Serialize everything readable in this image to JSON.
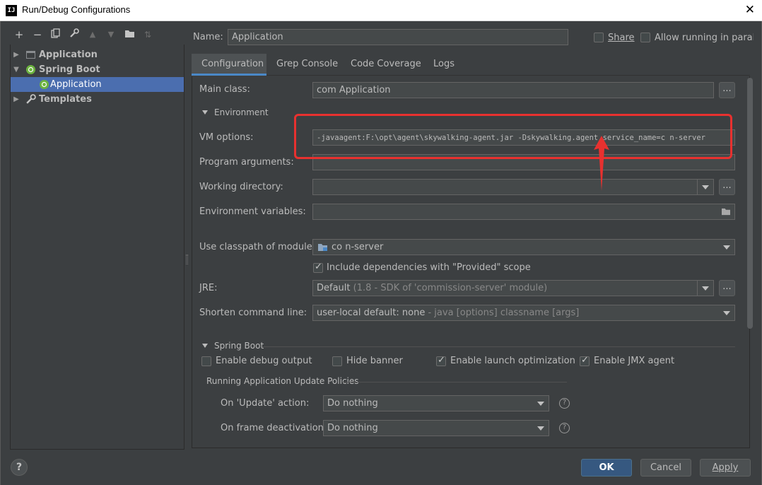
{
  "window": {
    "title": "Run/Debug Configurations",
    "app_icon": "IJ"
  },
  "toolbar": {
    "icons": [
      "add-icon",
      "remove-icon",
      "copy-icon",
      "wrench-icon",
      "move-up-icon",
      "move-down-icon",
      "folder-icon",
      "sort-icon"
    ]
  },
  "tree": {
    "items": [
      {
        "label": "Application",
        "icon": "application-icon"
      },
      {
        "label": "Spring Boot",
        "icon": "spring-boot-icon"
      },
      {
        "label": "Application",
        "icon": "spring-boot-icon"
      },
      {
        "label": "Templates",
        "icon": "wrench-icon"
      }
    ]
  },
  "header": {
    "name_label": "Name:",
    "name_value": "Application",
    "share_label": "Share",
    "allow_parallel_label": "Allow running in parallel"
  },
  "tabs": [
    "Configuration",
    "Grep Console",
    "Code Coverage",
    "Logs"
  ],
  "config": {
    "main_class_label": "Main class:",
    "main_class_value": "com                            Application",
    "environment_section": "Environment",
    "vm_options_label": "VM options:",
    "vm_options_value": "-javaagent:F:\\opt\\agent\\skywalking-agent.jar -Dskywalking.agent.service_name=c         n-server",
    "program_args_label": "Program arguments:",
    "working_dir_label": "Working directory:",
    "env_vars_label": "Environment variables:",
    "classpath_label": "Use classpath of module:",
    "classpath_value": "co           n-server",
    "include_deps_label": "Include dependencies with \"Provided\" scope",
    "jre_label": "JRE:",
    "jre_default": "Default",
    "jre_detail": "(1.8 - SDK of 'commission-server' module)",
    "shorten_label": "Shorten command line:",
    "shorten_value": "user-local default: none",
    "shorten_detail": "- java [options] classname [args]",
    "spring_section": "Spring Boot",
    "debug_output_label": "Enable debug output",
    "hide_banner_label": "Hide banner",
    "launch_opt_label": "Enable launch optimization",
    "jmx_label": "Enable JMX agent",
    "policies_label": "Running Application Update Policies",
    "on_update_label": "On 'Update' action:",
    "on_update_value": "Do nothing",
    "on_frame_label": "On frame deactivation:",
    "on_frame_value": "Do nothing"
  },
  "buttons": {
    "help": "?",
    "ok": "OK",
    "cancel": "Cancel",
    "apply": "Apply"
  },
  "colors": {
    "accent": "#4b6eaf",
    "annotation": "#e8312f",
    "primary_button": "#365880"
  }
}
